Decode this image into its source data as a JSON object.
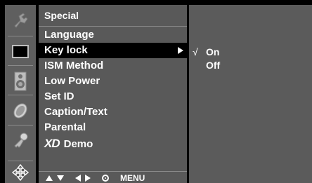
{
  "icons": [
    "tool-icon",
    "screen-icon",
    "speaker-icon",
    "clock-icon",
    "key-icon",
    "move-icon"
  ],
  "menu": {
    "title": "Special",
    "items": [
      {
        "label": "Language",
        "selected": false
      },
      {
        "label": "Key lock",
        "selected": true
      },
      {
        "label": "ISM Method",
        "selected": false
      },
      {
        "label": "Low Power",
        "selected": false
      },
      {
        "label": "Set ID",
        "selected": false
      },
      {
        "label": "Caption/Text",
        "selected": false
      },
      {
        "label": "Parental",
        "selected": false
      },
      {
        "label": "Demo",
        "logo": "XD",
        "selected": false
      }
    ],
    "nav_hint": "MENU"
  },
  "submenu": {
    "options": [
      {
        "label": "On",
        "checked": true,
        "check_mark": "√"
      },
      {
        "label": "Off",
        "checked": false
      }
    ]
  }
}
